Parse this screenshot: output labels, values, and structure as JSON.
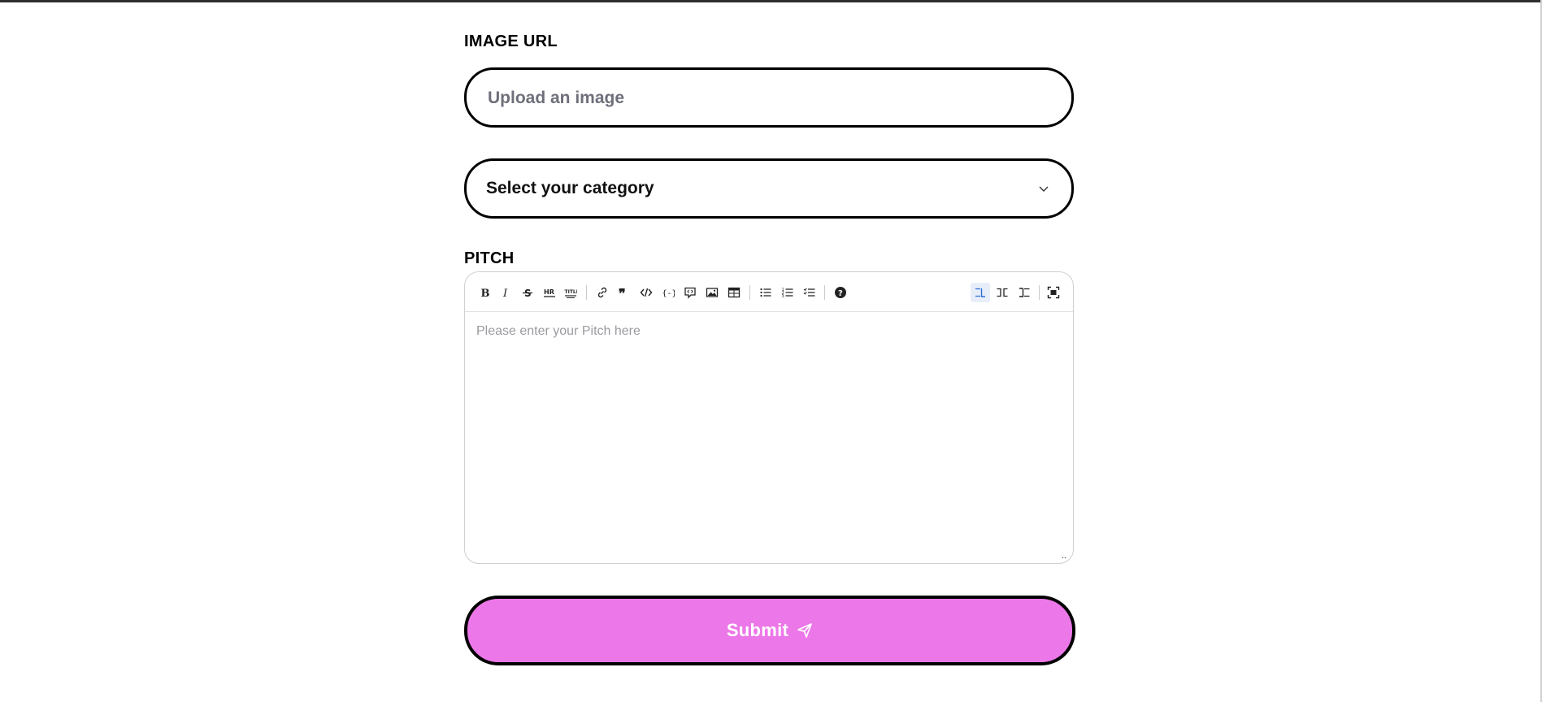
{
  "image_url": {
    "label": "IMAGE URL",
    "placeholder": "Upload an image",
    "value": ""
  },
  "category": {
    "selected": "Select your category",
    "icon": "chevron-down-icon"
  },
  "pitch": {
    "label": "PITCH",
    "placeholder": "Please enter your Pitch here",
    "value": "",
    "toolbar": [
      {
        "name": "bold-icon",
        "glyph": "B"
      },
      {
        "name": "italic-icon",
        "glyph": "I"
      },
      {
        "name": "strikethrough-icon"
      },
      {
        "name": "horizontal-rule-icon",
        "glyph": "HR"
      },
      {
        "name": "title-icon",
        "glyph": "TITLE"
      },
      {
        "name": "link-icon"
      },
      {
        "name": "quote-icon"
      },
      {
        "name": "code-icon"
      },
      {
        "name": "code-block-icon"
      },
      {
        "name": "comment-icon"
      },
      {
        "name": "image-icon"
      },
      {
        "name": "table-icon"
      },
      {
        "name": "unordered-list-icon"
      },
      {
        "name": "ordered-list-icon"
      },
      {
        "name": "checked-list-icon"
      },
      {
        "name": "help-icon"
      },
      {
        "name": "edit-mode-icon",
        "active": true
      },
      {
        "name": "live-mode-icon"
      },
      {
        "name": "preview-mode-icon"
      },
      {
        "name": "fullscreen-icon"
      }
    ],
    "resize_glyph": ".."
  },
  "submit": {
    "label": "Submit",
    "icon": "send-icon"
  },
  "colors": {
    "accent": "#ec77e8",
    "border": "#000000"
  }
}
